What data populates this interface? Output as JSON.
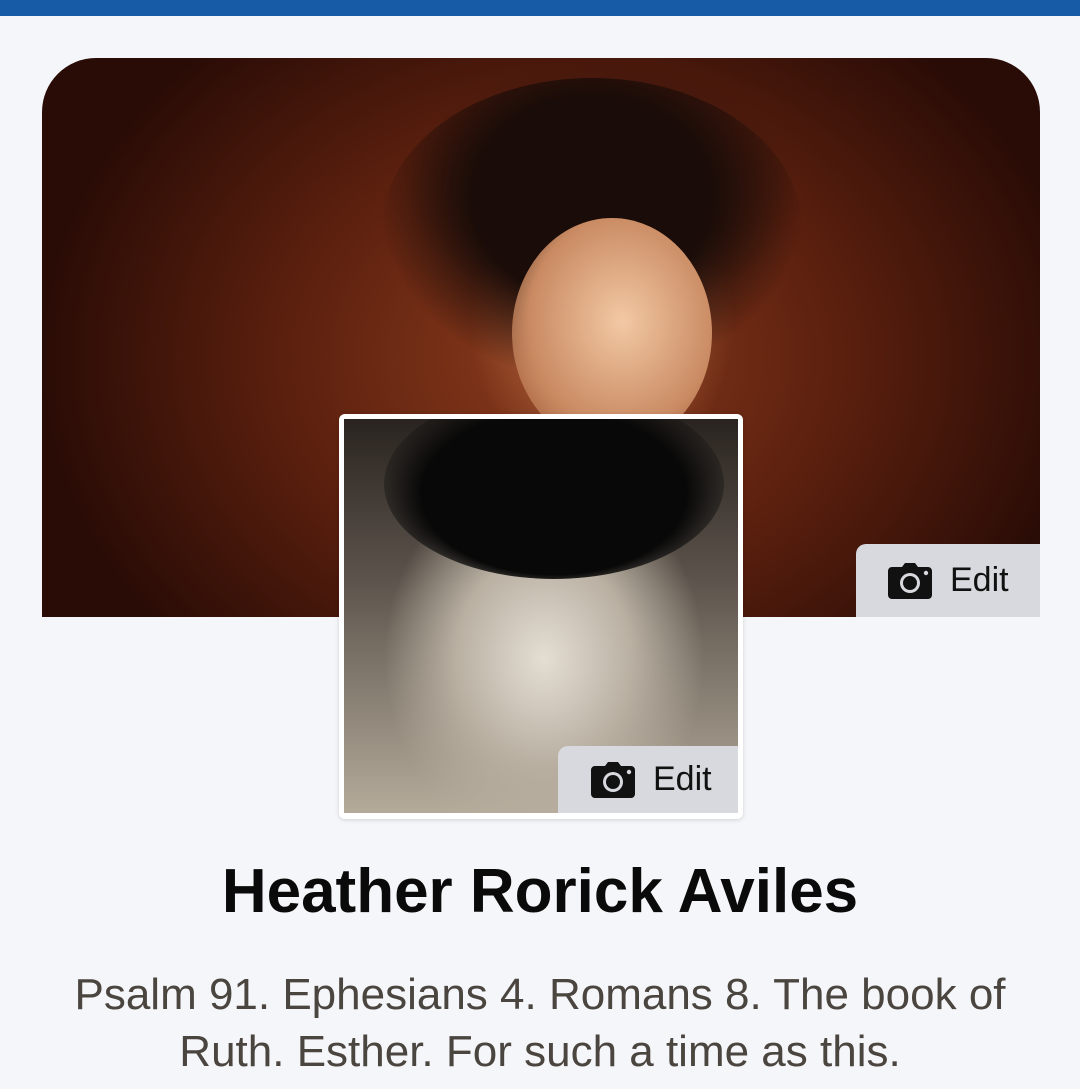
{
  "header": {
    "bar_color": "#175ba6"
  },
  "cover": {
    "edit_label": "Edit",
    "edit_icon": "camera-icon"
  },
  "profile_picture": {
    "edit_label": "Edit",
    "edit_icon": "camera-icon"
  },
  "profile": {
    "name": "Heather Rorick Aviles",
    "bio": "Psalm 91. Ephesians 4. Romans 8. The book of Ruth. Esther. For such a time as this."
  },
  "colors": {
    "background": "#f5f6f9",
    "edit_button_bg": "#d8d9de",
    "name_text": "#0a0a0a",
    "bio_text": "#4b4540"
  }
}
